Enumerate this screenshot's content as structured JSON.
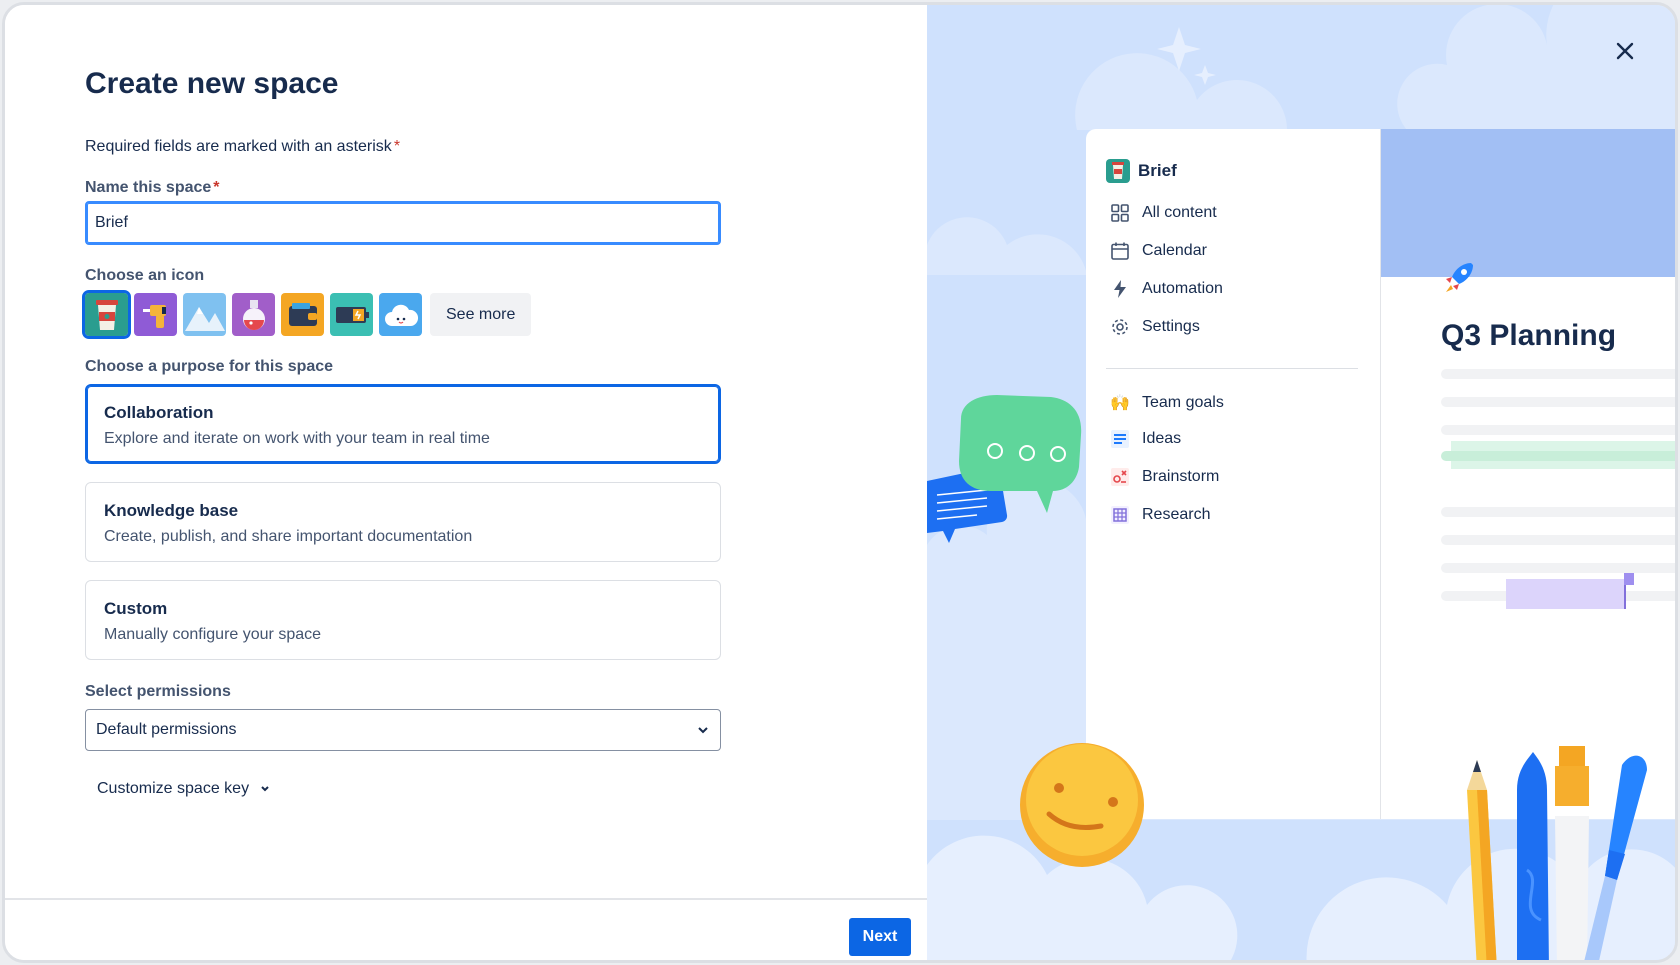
{
  "form": {
    "title": "Create new space",
    "required_note": "Required fields are marked with an asterisk",
    "asterisk": "*",
    "name_label": "Name this space",
    "name_value": "Brief",
    "icon_label": "Choose an icon",
    "icons": [
      "coffee-cup-icon",
      "drill-icon",
      "mountains-icon",
      "potion-icon",
      "wallet-icon",
      "battery-icon",
      "cloud-icon"
    ],
    "see_more": "See more",
    "purpose_label": "Choose a purpose for this space",
    "purposes": [
      {
        "title": "Collaboration",
        "desc": "Explore and iterate on work with your team in real time"
      },
      {
        "title": "Knowledge base",
        "desc": "Create, publish, and share important documentation"
      },
      {
        "title": "Custom",
        "desc": "Manually configure your space"
      }
    ],
    "permissions_label": "Select permissions",
    "permissions_value": "Default permissions",
    "customize_key": "Customize space key",
    "next": "Next"
  },
  "preview": {
    "space_name": "Brief",
    "nav": [
      "All content",
      "Calendar",
      "Automation",
      "Settings"
    ],
    "pages": [
      "Team goals",
      "Ideas",
      "Brainstorm",
      "Research"
    ],
    "page_title": "Q3 Planning"
  },
  "colors": {
    "accent": "#0c66e4",
    "required": "#c9372c",
    "illustration_bg": "#cfe1fd"
  }
}
